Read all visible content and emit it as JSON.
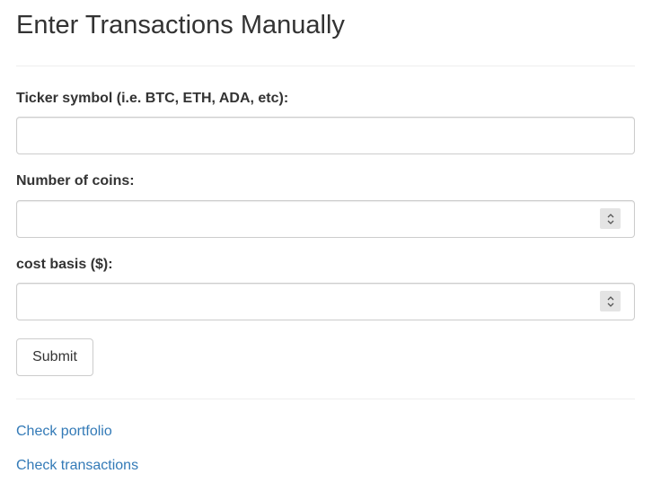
{
  "page": {
    "title": "Enter Transactions Manually"
  },
  "form": {
    "ticker": {
      "label": "Ticker symbol (i.e. BTC, ETH, ADA, etc):",
      "value": "",
      "placeholder": ""
    },
    "coins": {
      "label": "Number of coins:",
      "value": "",
      "placeholder": "",
      "spinner_icon": "spinner-up-down-icon"
    },
    "cost_basis": {
      "label": "cost basis ($):",
      "value": "",
      "placeholder": "",
      "spinner_icon": "spinner-up-down-icon"
    },
    "submit_label": "Submit"
  },
  "links": {
    "portfolio": "Check portfolio",
    "transactions": "Check transactions"
  },
  "colors": {
    "text": "#333333",
    "link": "#337ab7",
    "border": "#cccccc",
    "divider": "#eeeeee",
    "spinner_bg": "#e4e4e4"
  }
}
